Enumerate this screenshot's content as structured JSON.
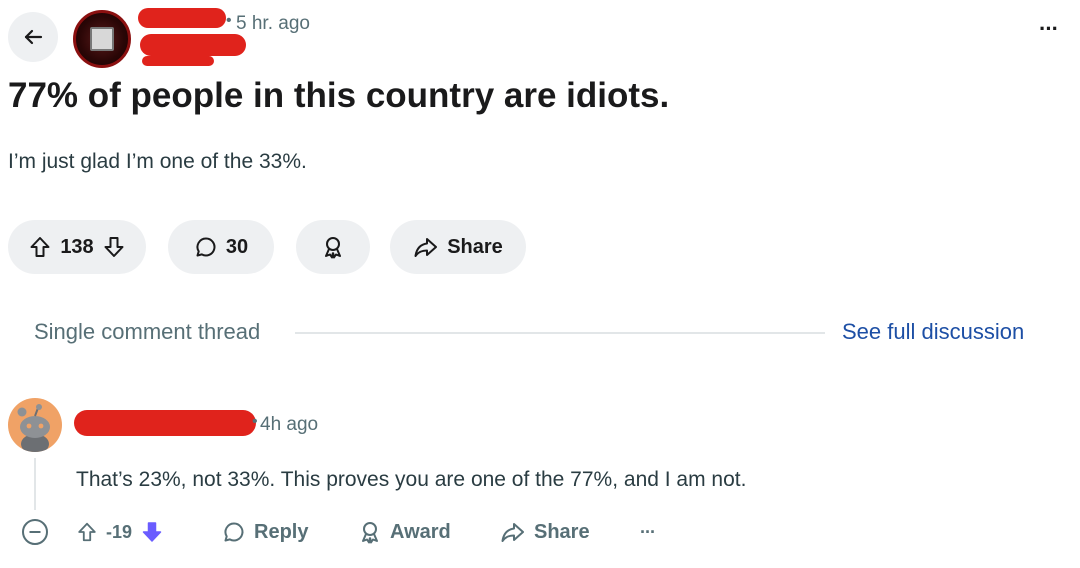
{
  "post": {
    "time": "5 hr. ago",
    "title": "77% of people in this country are idiots.",
    "body": "I’m just glad I’m one of the 33%.",
    "upvotes": "138",
    "comments": "30",
    "share_label": "Share"
  },
  "thread": {
    "label": "Single comment thread",
    "see_full": "See full discussion"
  },
  "comment": {
    "time": "4h ago",
    "body": "That’s 23%, not 33%. This proves you are one of the 77%, and I am not.",
    "score": "-19",
    "reply_label": "Reply",
    "award_label": "Award",
    "share_label": "Share"
  },
  "icons": {
    "back": "arrow-left-icon",
    "more": "more-horizontal-icon",
    "upvote": "upvote-arrow-icon",
    "downvote": "downvote-arrow-icon",
    "comment": "comment-bubble-icon",
    "award": "award-icon",
    "share": "share-arrow-icon",
    "collapse": "collapse-minus-icon"
  },
  "colors": {
    "redaction": "#e0231c",
    "downvote_active": "#6a5cff",
    "link": "#1d4fa5",
    "pill_bg": "#eef0f2"
  }
}
